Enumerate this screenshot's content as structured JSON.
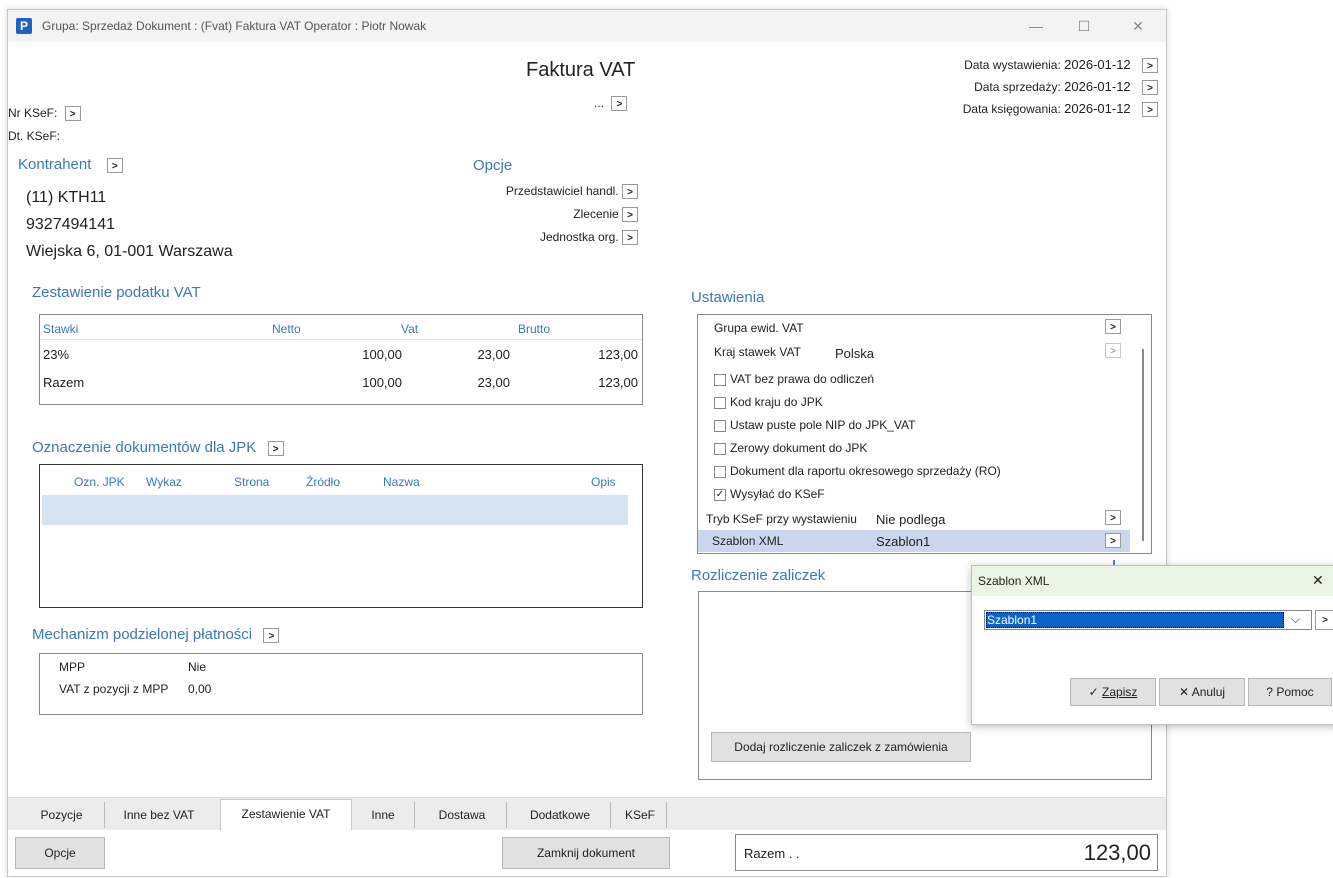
{
  "window": {
    "title": "Grupa: Sprzedaż   Dokument : (Fvat) Faktura VAT   Operator : Piotr Nowak",
    "logo": "P",
    "min_icon": "—",
    "max_icon": "☐",
    "close_icon": "✕"
  },
  "doc": {
    "title": "Faktura VAT",
    "ellipsis": "...",
    "nr_ksef_label": "Nr KSeF:",
    "dt_ksef_label": "Dt. KSeF:",
    "dates": [
      {
        "label": "Data wystawienia:",
        "value": "2026-01-12"
      },
      {
        "label": "Data sprzedaży:",
        "value": "2026-01-12"
      },
      {
        "label": "Data księgowania:",
        "value": "2026-01-12"
      }
    ]
  },
  "kontrahent": {
    "heading": "Kontrahent",
    "code": "(11) KTH11",
    "nip": "9327494141",
    "address": "Wiejska 6, 01-001 Warszawa"
  },
  "opcje": {
    "heading": "Opcje",
    "items": [
      "Przedstawiciel handl.",
      "Zlecenie",
      "Jednostka org."
    ]
  },
  "vat": {
    "heading": "Zestawienie podatku VAT",
    "columns": [
      "Stawki",
      "Netto",
      "Vat",
      "Brutto"
    ],
    "rows": [
      [
        "23%",
        "100,00",
        "23,00",
        "123,00"
      ],
      [
        "Razem",
        "100,00",
        "23,00",
        "123,00"
      ]
    ]
  },
  "jpk": {
    "heading": "Oznaczenie dokumentów dla JPK",
    "columns": [
      "Ozn. JPK",
      "Wykaz",
      "Strona",
      "Źródło",
      "Nazwa",
      "Opis"
    ]
  },
  "mpp": {
    "heading": "Mechanizm podzielonej płatności",
    "mpp_label": "MPP",
    "mpp_value": "Nie",
    "vat_label": "VAT z pozycji z MPP",
    "vat_value": "0,00"
  },
  "ustawienia": {
    "heading": "Ustawienia",
    "grupa_label": "Grupa ewid. VAT",
    "kraj_label": "Kraj stawek VAT",
    "kraj_value": "Polska",
    "checkboxes": [
      {
        "label": "VAT bez prawa do odliczeń",
        "checked": false
      },
      {
        "label": "Kod kraju do JPK",
        "checked": false
      },
      {
        "label": "Ustaw puste pole NIP do JPK_VAT",
        "checked": false
      },
      {
        "label": "Zerowy dokument do JPK",
        "checked": false
      },
      {
        "label": "Dokument dla raportu okresowego sprzedaży (RO)",
        "checked": false
      },
      {
        "label": "Wysyłać do KSeF",
        "checked": true
      }
    ],
    "tryb_label": "Tryb KSeF przy wystawieniu",
    "tryb_value": "Nie podlega",
    "szablon_label": "Szablon XML",
    "szablon_value": "Szablon1"
  },
  "zaliczki": {
    "heading": "Rozliczenie zaliczek",
    "button": "Dodaj rozliczenie zaliczek z zamówienia"
  },
  "tabs": [
    {
      "label": "Pozycje"
    },
    {
      "label": "Inne bez VAT"
    },
    {
      "label": "Zestawienie VAT"
    },
    {
      "label": "Inne"
    },
    {
      "label": "Dostawa"
    },
    {
      "label": "Dodatkowe"
    },
    {
      "label": "KSeF"
    }
  ],
  "footer": {
    "opcje_button": "Opcje",
    "zamknij_button": "Zamknij dokument",
    "razem_label": "Razem . .",
    "razem_value": "123,00"
  },
  "dialog": {
    "title": "Szablon XML",
    "close_icon": "✕",
    "selected": "Szablon1",
    "zapisz": "Zapisz",
    "anuluj": "Anuluj",
    "pomoc": "Pomoc"
  },
  "colors": {
    "accent": "#3a78b8",
    "selection": "#d5e3f3",
    "dialog_header": "#eaf6e3",
    "arrow_indicator": "#4a7fd0"
  }
}
